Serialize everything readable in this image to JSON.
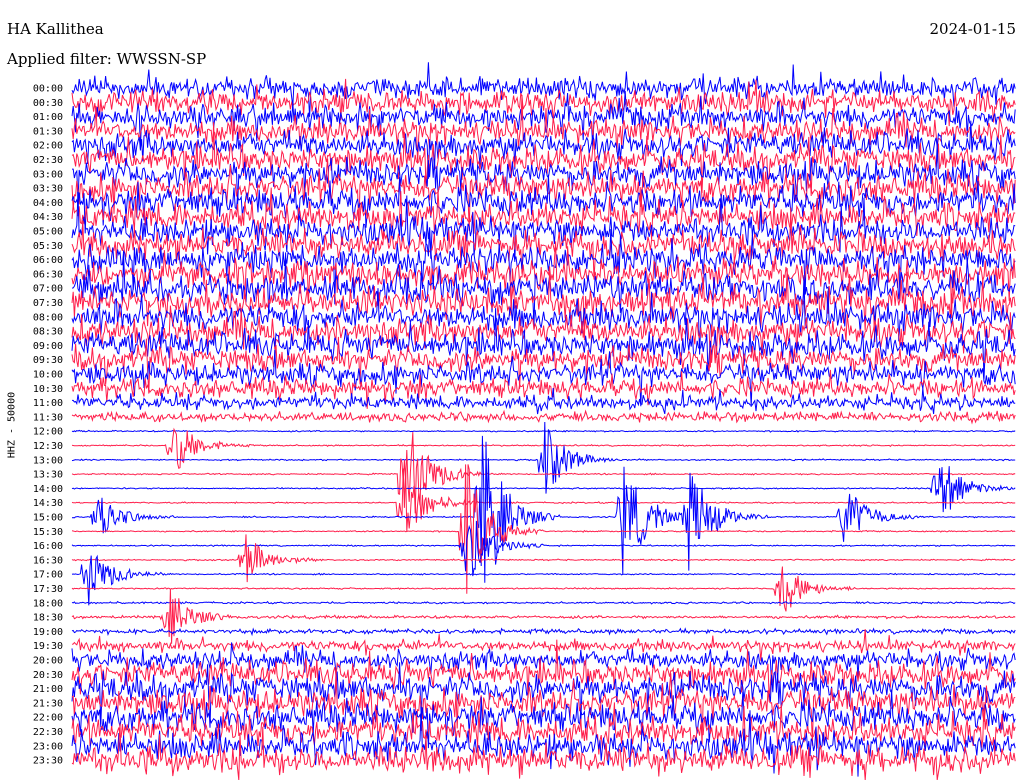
{
  "header": {
    "station": "HA Kallithea",
    "date": "2024-01-15",
    "filter": "Applied filter: WWSSN-SP"
  },
  "chart_data": {
    "type": "line",
    "title": "HA Kallithea",
    "subtitle": "Applied filter: WWSSN-SP",
    "date": "2024-01-15",
    "ylabel": "HHZ - 50000",
    "xlabel": "",
    "grid": false,
    "legend": "none",
    "colors": [
      "#0000ff",
      "#ff1e4b"
    ],
    "rows": [
      "00:00",
      "00:30",
      "01:00",
      "01:30",
      "02:00",
      "02:30",
      "03:00",
      "03:30",
      "04:00",
      "04:30",
      "05:00",
      "05:30",
      "06:00",
      "06:30",
      "07:00",
      "07:30",
      "08:00",
      "08:30",
      "09:00",
      "09:30",
      "10:00",
      "10:30",
      "11:00",
      "11:30",
      "12:00",
      "12:30",
      "13:00",
      "13:30",
      "14:00",
      "14:30",
      "15:00",
      "15:30",
      "16:00",
      "16:30",
      "17:00",
      "17:30",
      "18:00",
      "18:30",
      "19:00",
      "19:30",
      "20:00",
      "20:30",
      "21:00",
      "21:30",
      "22:00",
      "22:30",
      "23:00",
      "23:30"
    ],
    "noise_level": [
      2.2,
      2.4,
      2.5,
      2.6,
      2.7,
      2.8,
      2.9,
      3.0,
      3.0,
      3.0,
      3.0,
      3.0,
      3.0,
      3.0,
      3.0,
      3.0,
      3.0,
      2.9,
      2.8,
      2.6,
      2.3,
      2.0,
      1.5,
      1.0,
      0.15,
      0.15,
      0.15,
      0.15,
      0.15,
      0.15,
      0.15,
      0.15,
      0.15,
      0.15,
      0.15,
      0.15,
      0.2,
      0.3,
      0.5,
      1.2,
      2.0,
      2.6,
      3.0,
      3.0,
      3.0,
      3.0,
      3.0,
      3.0
    ],
    "events": [
      {
        "row": 25,
        "minute": 3.2,
        "amp": 1.4
      },
      {
        "row": 26,
        "minute": 15.0,
        "amp": 1.8
      },
      {
        "row": 27,
        "minute": 10.5,
        "amp": 3.5
      },
      {
        "row": 29,
        "minute": 10.5,
        "amp": 2.0
      },
      {
        "row": 30,
        "minute": 0.8,
        "amp": 1.2
      },
      {
        "row": 30,
        "minute": 13.0,
        "amp": 4.5
      },
      {
        "row": 30,
        "minute": 17.5,
        "amp": 3.0
      },
      {
        "row": 30,
        "minute": 19.6,
        "amp": 2.5
      },
      {
        "row": 30,
        "minute": 24.5,
        "amp": 1.8
      },
      {
        "row": 31,
        "minute": 12.5,
        "amp": 3.5
      },
      {
        "row": 32,
        "minute": 12.5,
        "amp": 2.0
      },
      {
        "row": 33,
        "minute": 5.5,
        "amp": 1.2
      },
      {
        "row": 34,
        "minute": 0.5,
        "amp": 1.5
      },
      {
        "row": 35,
        "minute": 22.5,
        "amp": 1.4
      },
      {
        "row": 37,
        "minute": 3.0,
        "amp": 1.5
      },
      {
        "row": 28,
        "minute": 27.5,
        "amp": 1.8
      }
    ]
  }
}
